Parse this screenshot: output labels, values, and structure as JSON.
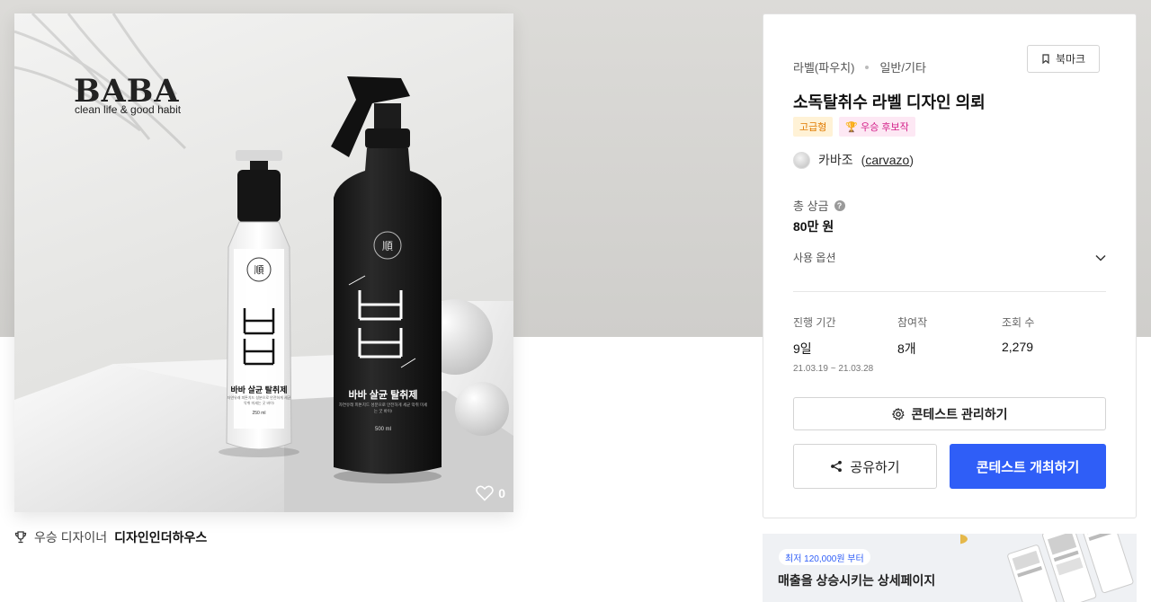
{
  "hero": {
    "brand": "BABA",
    "tagline": "clean life & good habit",
    "small_bottle": {
      "name": "바바 살균 탈취제",
      "desc": "자연유래 피톤치드 성분으로 안전하게 세균 악취 미세는 굿 바이!",
      "volume": "250 ml"
    },
    "big_bottle": {
      "name": "바바 살균 탈취제",
      "desc": "자연유래 피톤치드 성분으로 안전하게 세균 악취 미세는 굿 바이!",
      "volume": "500 ml"
    },
    "likes": "0"
  },
  "winner": {
    "label": "우승 디자이너",
    "name": "디자인인더하우스"
  },
  "panel": {
    "category": "라벨(파우치)",
    "subcategory": "일반/기타",
    "bookmark_label": "북마크",
    "title": "소독탈취수 라벨 디자인 의뢰",
    "badge_grade": "고급형",
    "badge_winner": "우승 후보작",
    "designer_name": "카바조",
    "designer_handle": "carvazo",
    "prize_label": "총 상금",
    "prize_value": "80만 원",
    "options_label": "사용 옵션",
    "stats": {
      "period_label": "진행 기간",
      "period_value": "9일",
      "period_range": "21.03.19 ~ 21.03.28",
      "entries_label": "참여작",
      "entries_value": "8개",
      "views_label": "조회 수",
      "views_value": "2,279"
    },
    "manage_label": "콘테스트 관리하기",
    "share_label": "공유하기",
    "host_label": "콘테스트 개최하기"
  },
  "ad": {
    "tag": "최저 120,000원 부터",
    "title": "매출을 상승시키는 상세페이지"
  },
  "colors": {
    "primary": "#2f5ef7",
    "badge_grade_bg": "#fff2d6",
    "badge_grade_text": "#e07a00",
    "badge_winner_bg": "#fde8f4",
    "badge_winner_text": "#d4218a"
  }
}
